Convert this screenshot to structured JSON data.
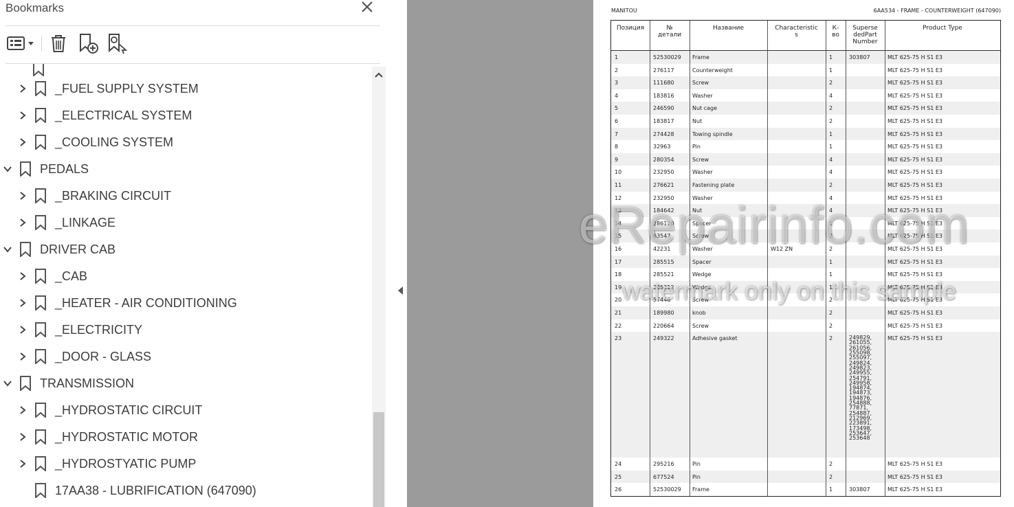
{
  "bookmarks_panel": {
    "title": "Bookmarks",
    "close_icon": "close-icon",
    "toolbar_icons": [
      "options-menu-icon",
      "trash-icon",
      "add-bookmark-icon",
      "find-bookmark-icon"
    ],
    "items": [
      {
        "label": "_FUEL SUPPLY SYSTEM",
        "level": 1,
        "expandable": true,
        "expanded": false
      },
      {
        "label": "_ELECTRICAL SYSTEM",
        "level": 1,
        "expandable": true,
        "expanded": false
      },
      {
        "label": "_COOLING SYSTEM",
        "level": 1,
        "expandable": true,
        "expanded": false
      },
      {
        "label": "PEDALS",
        "level": 0,
        "expandable": true,
        "expanded": true
      },
      {
        "label": "_BRAKING CIRCUIT",
        "level": 1,
        "expandable": true,
        "expanded": false
      },
      {
        "label": "_LINKAGE",
        "level": 1,
        "expandable": true,
        "expanded": false
      },
      {
        "label": "DRIVER CAB",
        "level": 0,
        "expandable": true,
        "expanded": true
      },
      {
        "label": "_CAB",
        "level": 1,
        "expandable": true,
        "expanded": false
      },
      {
        "label": "_HEATER - AIR CONDITIONING",
        "level": 1,
        "expandable": true,
        "expanded": false
      },
      {
        "label": "_ELECTRICITY",
        "level": 1,
        "expandable": true,
        "expanded": false
      },
      {
        "label": "_DOOR - GLASS",
        "level": 1,
        "expandable": true,
        "expanded": false
      },
      {
        "label": "TRANSMISSION",
        "level": 0,
        "expandable": true,
        "expanded": true
      },
      {
        "label": "_HYDROSTATIC CIRCUIT",
        "level": 1,
        "expandable": true,
        "expanded": false
      },
      {
        "label": "_HYDROSTATIC MOTOR",
        "level": 1,
        "expandable": true,
        "expanded": false
      },
      {
        "label": "_HYDROSTYATIC PUMP",
        "level": 1,
        "expandable": true,
        "expanded": false
      },
      {
        "label": "17AA38 - LUBRIFICATION (647090)",
        "level": 1,
        "expandable": false,
        "expanded": false
      }
    ]
  },
  "document": {
    "header_left": "MANITOU",
    "header_right": "6AA534 - FRAME - COUNTERWEIGHT (647090)",
    "columns": [
      "Позиция",
      "№\nдетали",
      "Название",
      "Characteristic\ns",
      "К-\nво",
      "Superse\ndedPart\nNumber",
      "Product Type"
    ],
    "rows": [
      [
        "1",
        "52530029",
        "Frame",
        "",
        "1",
        "303807",
        "MLT 625-75 H S1 E3"
      ],
      [
        "2",
        "276117",
        "Counterweight",
        "",
        "1",
        "",
        "MLT 625-75 H S1 E3"
      ],
      [
        "3",
        "111680",
        "Screw",
        "",
        "2",
        "",
        "MLT 625-75 H S1 E3"
      ],
      [
        "4",
        "183816",
        "Washer",
        "",
        "4",
        "",
        "MLT 625-75 H S1 E3"
      ],
      [
        "5",
        "246590",
        "Nut cage",
        "",
        "2",
        "",
        "MLT 625-75 H S1 E3"
      ],
      [
        "6",
        "183817",
        "Nut",
        "",
        "2",
        "",
        "MLT 625-75 H S1 E3"
      ],
      [
        "7",
        "274428",
        "Towing spindle",
        "",
        "1",
        "",
        "MLT 625-75 H S1 E3"
      ],
      [
        "8",
        "32963",
        "Pin",
        "",
        "1",
        "",
        "MLT 625-75 H S1 E3"
      ],
      [
        "9",
        "280354",
        "Screw",
        "",
        "4",
        "",
        "MLT 625-75 H S1 E3"
      ],
      [
        "10",
        "232950",
        "Washer",
        "",
        "4",
        "",
        "MLT 625-75 H S1 E3"
      ],
      [
        "11",
        "276621",
        "Fastening plate",
        "",
        "2",
        "",
        "MLT 625-75 H S1 E3"
      ],
      [
        "12",
        "232950",
        "Washer",
        "",
        "4",
        "",
        "MLT 625-75 H S1 E3"
      ],
      [
        "13",
        "184642",
        "Nut",
        "",
        "4",
        "",
        "MLT 625-75 H S1 E3"
      ],
      [
        "14",
        "286110",
        "Spacer",
        "",
        "1",
        "",
        "MLT 625-75 H S1 E3"
      ],
      [
        "15",
        "63547",
        "Screw",
        "",
        "2",
        "",
        "MLT 625-75 H S1 E3"
      ],
      [
        "16",
        "42231",
        "Washer",
        "W12 ZN",
        "2",
        "",
        "MLT 625-75 H S1 E3"
      ],
      [
        "17",
        "285515",
        "Spacer",
        "",
        "1",
        "",
        "MLT 625-75 H S1 E3"
      ],
      [
        "18",
        "285521",
        "Wedge",
        "",
        "1",
        "",
        "MLT 625-75 H S1 E3"
      ],
      [
        "19",
        "295212",
        "Wedge",
        "",
        "1",
        "",
        "MLT 625-75 H S1 E3"
      ],
      [
        "20",
        "57446",
        "Screw",
        "",
        "2",
        "",
        "MLT 625-75 H S1 E3"
      ],
      [
        "21",
        "189980",
        "knob",
        "",
        "2",
        "",
        "MLT 625-75 H S1 E3"
      ],
      [
        "22",
        "220664",
        "Screw",
        "",
        "2",
        "",
        "MLT 625-75 H S1 E3"
      ],
      [
        "23",
        "249322",
        "Adhesive gasket",
        "",
        "2",
        "249829,\n261055,\n261056,\n255098,\n255097,\n249824,\n249823,\n249955,\n254791,\n249958,\n194874,\n194873,\n194876,\n254888,\n77871,\n254887,\n212969,\n223891,\n173498,\n253647,\n253648",
        "MLT 625-75 H S1 E3"
      ],
      [
        "24",
        "295216",
        "Pin",
        "",
        "2",
        "",
        "MLT 625-75 H S1 E3"
      ],
      [
        "25",
        "677524",
        "Pin",
        "",
        "2",
        "",
        "MLT 625-75 H S1 E3"
      ],
      [
        "26",
        "52530029",
        "Frame",
        "",
        "1",
        "303807",
        "MLT 625-75 H S1 E3"
      ]
    ],
    "watermark_main": "eRepairinfo.com",
    "watermark_sub": "watermark only on this sample"
  },
  "colors": {
    "pane_text": "#3c3c3c",
    "doc_background": "#9b9b9b",
    "row_alt": "#efefef"
  }
}
